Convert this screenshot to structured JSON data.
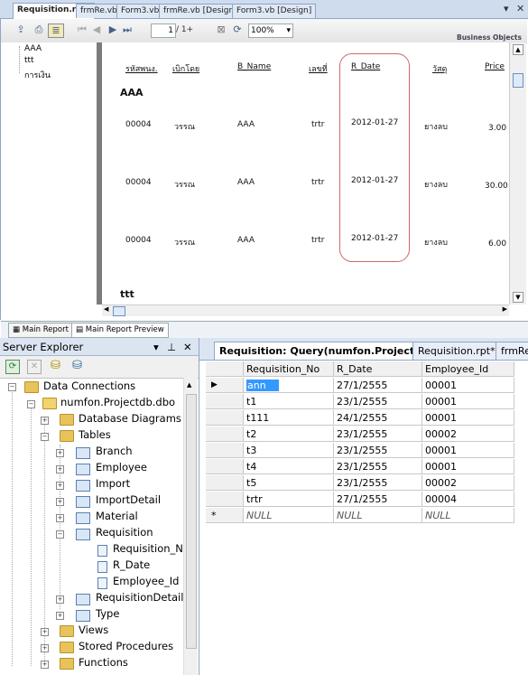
{
  "top_tabs": [
    {
      "label": "Requisition.rpt*",
      "active": true
    },
    {
      "label": "frmRe.vb",
      "active": false
    },
    {
      "label": "Form3.vb",
      "active": false
    },
    {
      "label": "frmRe.vb [Design]",
      "active": false
    },
    {
      "label": "Form3.vb [Design]",
      "active": false
    }
  ],
  "viewer_toolbar": {
    "page_value": "1",
    "page_total": "/ 1+",
    "zoom": "100%",
    "brand": "Business Objects"
  },
  "tree": {
    "items": [
      "AAA",
      "ttt",
      "การเงิน"
    ]
  },
  "report": {
    "headers": [
      "รหัสพนง.",
      "เบิกโดย",
      "B_Name",
      "เลขที่",
      "R_Date",
      "วัสดุ",
      "Price"
    ],
    "group1": "AAA",
    "rows": [
      {
        "emp": "00004",
        "by": "วรรณ",
        "bname": "AAA",
        "no": "trtr",
        "rdate": "2012-01-27",
        "item": "ยางลบ",
        "price": "3.00"
      },
      {
        "emp": "00004",
        "by": "วรรณ",
        "bname": "AAA",
        "no": "trtr",
        "rdate": "2012-01-27",
        "item": "ยางลบ",
        "price": "30.00"
      },
      {
        "emp": "00004",
        "by": "วรรณ",
        "bname": "AAA",
        "no": "trtr",
        "rdate": "2012-01-27",
        "item": "ยางลบ",
        "price": "6.00"
      }
    ],
    "group2": "ttt"
  },
  "bottom_tabs": [
    "Main Report",
    "Main Report Preview"
  ],
  "server_explorer": {
    "title": "Server Explorer",
    "root": "Data Connections",
    "db": "numfon.Projectdb.dbo",
    "database_diagrams": "Database Diagrams",
    "tables_label": "Tables",
    "tables": [
      "Branch",
      "Employee",
      "Import",
      "ImportDetail",
      "Material",
      "Requisition"
    ],
    "requisition_columns": [
      "Requisition_No",
      "R_Date",
      "Employee_Id"
    ],
    "tables_after": [
      "RequisitionDetail",
      "Type"
    ],
    "folders": [
      "Views",
      "Stored Procedures",
      "Functions"
    ]
  },
  "query_tabs": [
    {
      "label": "Requisition: Query(numfon.Projectdb)",
      "active": true
    },
    {
      "label": "Requisition.rpt*",
      "active": false
    },
    {
      "label": "frmRe",
      "active": false
    }
  ],
  "grid": {
    "columns": [
      "Requisition_No",
      "R_Date",
      "Employee_Id"
    ],
    "rows": [
      [
        "ann",
        "27/1/2555",
        "00001"
      ],
      [
        "t1",
        "23/1/2555",
        "00001"
      ],
      [
        "t111",
        "24/1/2555",
        "00001"
      ],
      [
        "t2",
        "23/1/2555",
        "00002"
      ],
      [
        "t3",
        "23/1/2555",
        "00001"
      ],
      [
        "t4",
        "23/1/2555",
        "00001"
      ],
      [
        "t5",
        "23/1/2555",
        "00002"
      ],
      [
        "trtr",
        "27/1/2555",
        "00004"
      ]
    ],
    "new_row": [
      "NULL",
      "NULL",
      "NULL"
    ],
    "new_row_marker": "*",
    "current_row_marker": "▶"
  },
  "colors": {
    "accent": "#3399ff",
    "highlight_box": "#d06868"
  }
}
